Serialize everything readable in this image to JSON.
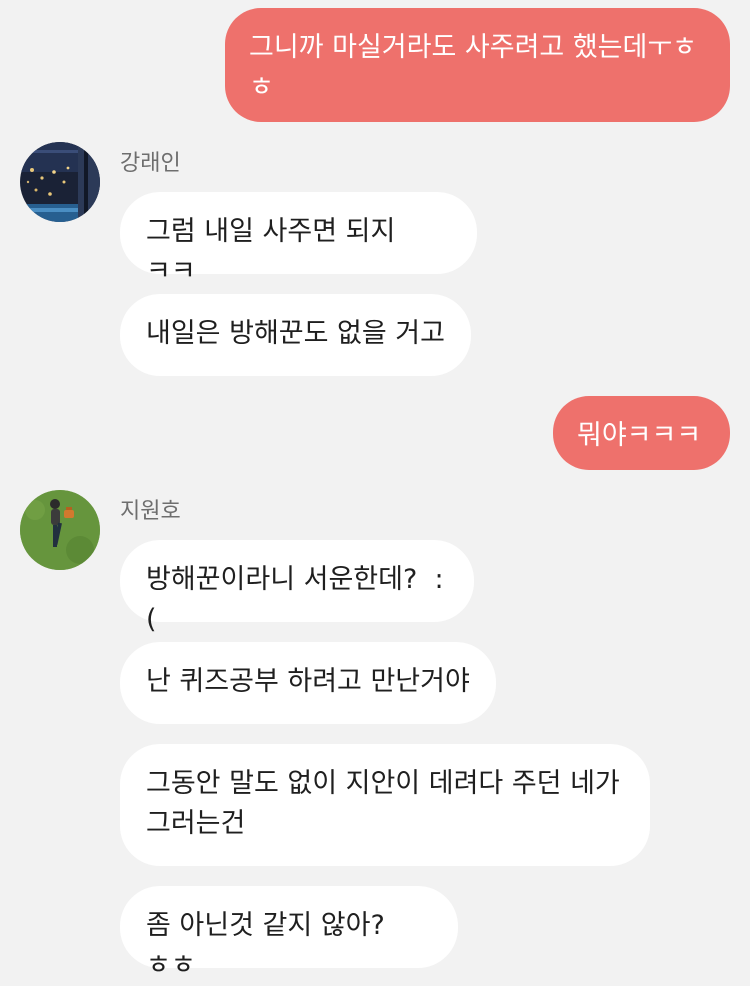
{
  "colors": {
    "background": "#f2f2f2",
    "incoming_bubble": "#ffffff",
    "outgoing_bubble": "#ee716c"
  },
  "messages": {
    "m1": "그니까 마실거라도 사주려고 했는데ㅜㅎ\nㅎ",
    "m2": "그럼 내일 사주면 되지 ㅋㅋ",
    "m3": "내일은 방해꾼도 없을 거고",
    "m4": "뭐야ㅋㅋㅋ",
    "m5": "방해꾼이라니 서운한데?  :(",
    "m6": "난 퀴즈공부 하려고 만난거야",
    "m7": "그동안 말도 없이 지안이 데려다 주던 네가\n그러는건",
    "m8": "좀 아닌것 같지 않아?ㅎㅎ"
  },
  "senders": {
    "kang": {
      "name": "강래인",
      "avatar_icon": "night-window-avatar"
    },
    "ji": {
      "name": "지원호",
      "avatar_icon": "person-on-grass-avatar"
    }
  }
}
